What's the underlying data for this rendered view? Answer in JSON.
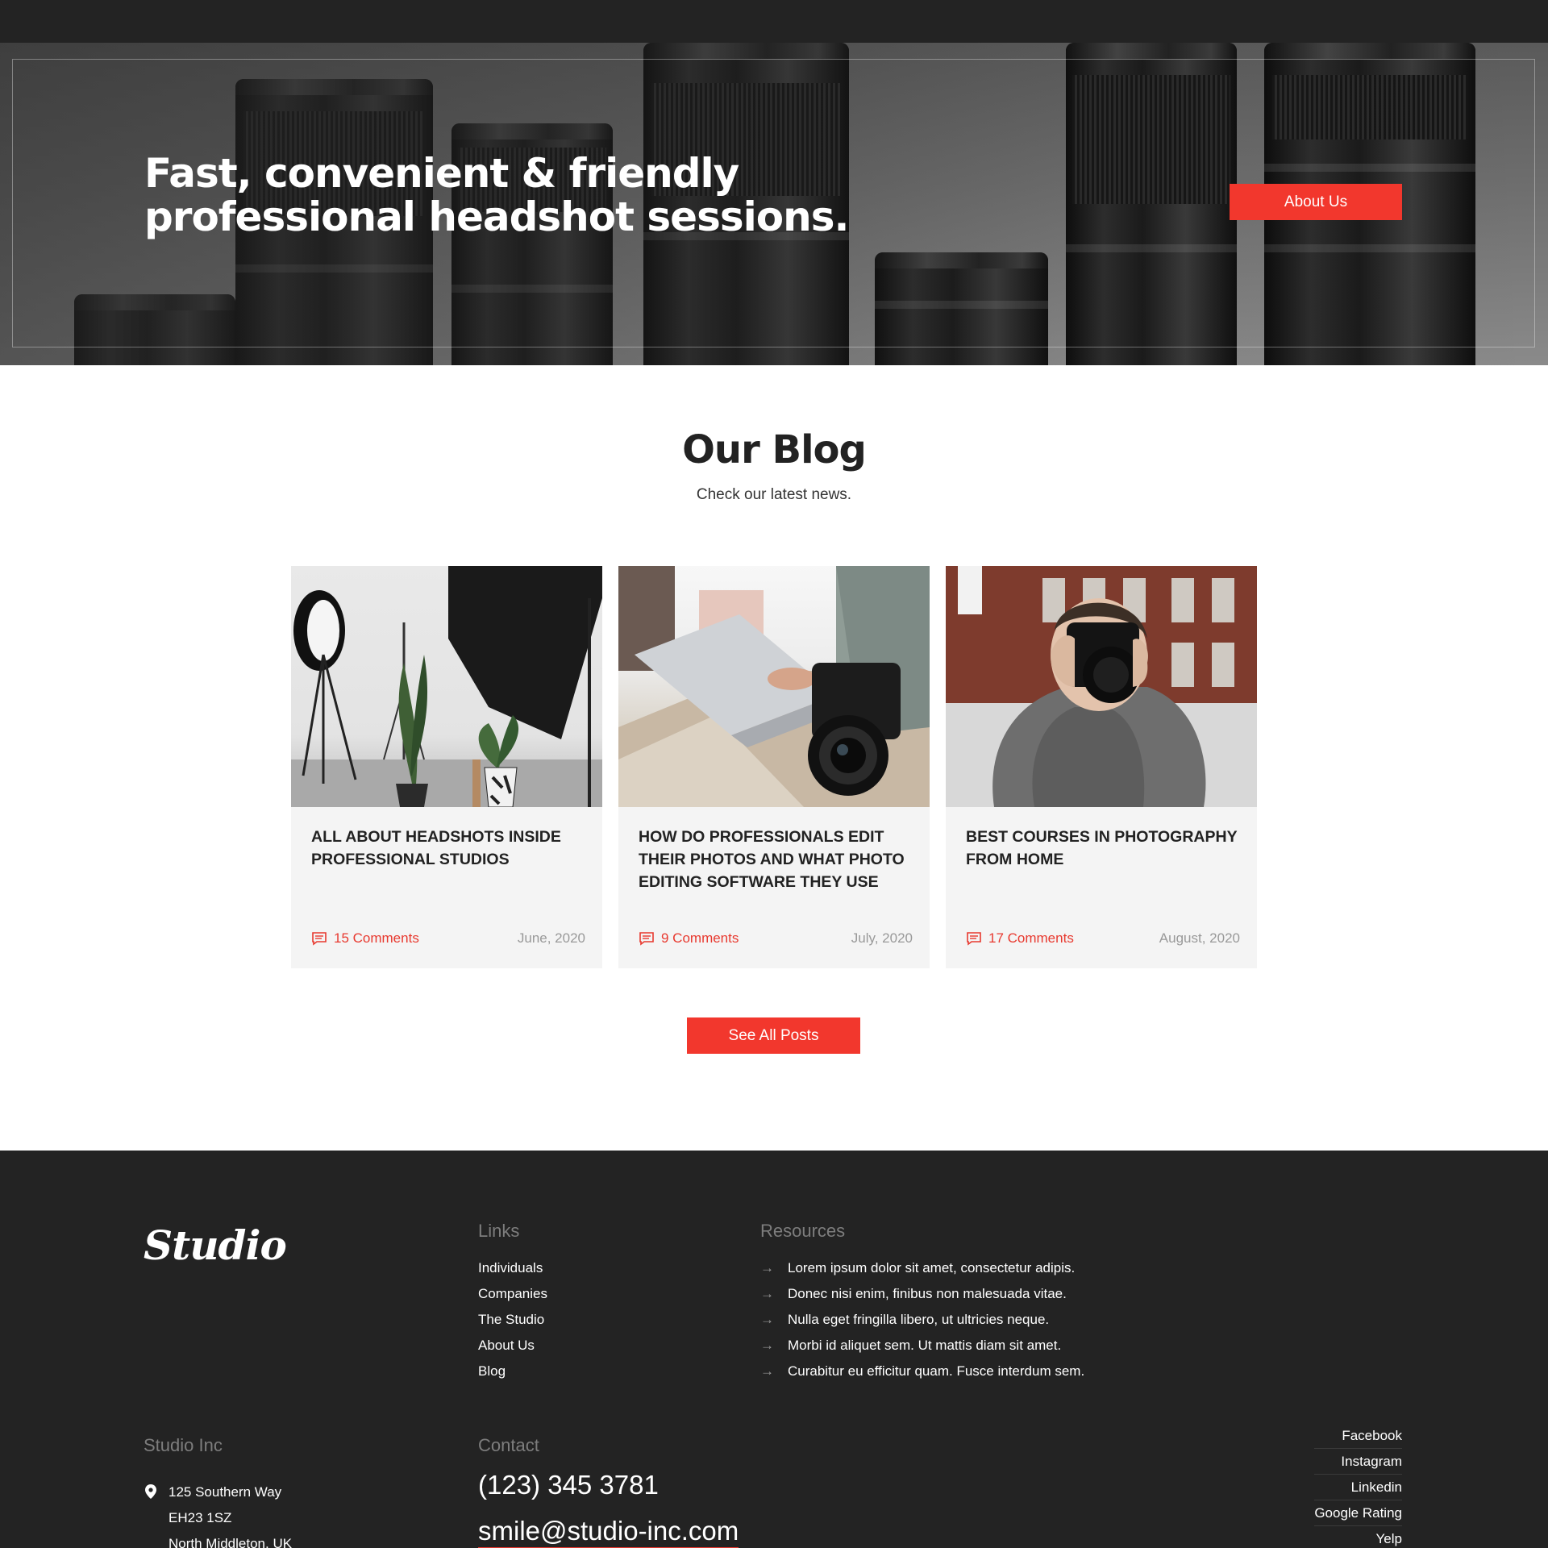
{
  "hero": {
    "headline": "Fast, convenient & friendly professional headshot sessions.",
    "cta": "About Us"
  },
  "blog": {
    "title": "Our Blog",
    "subtitle": "Check our latest news.",
    "posts": [
      {
        "title": "ALL ABOUT HEADSHOTS INSIDE PROFESSIONAL STUDIOS",
        "comments": "15 Comments",
        "date": "June, 2020"
      },
      {
        "title": "HOW DO PROFESSIONALS EDIT THEIR PHOTOS AND WHAT PHOTO EDITING SOFTWARE THEY USE",
        "comments": "9 Comments",
        "date": "July, 2020"
      },
      {
        "title": "BEST COURSES IN PHOTOGRAPHY FROM HOME",
        "comments": "17 Comments",
        "date": "August, 2020"
      }
    ],
    "see_all": "See All Posts"
  },
  "footer": {
    "logo": "Studio",
    "links_heading": "Links",
    "links": [
      "Individuals",
      "Companies",
      "The Studio",
      "About Us",
      "Blog"
    ],
    "resources_heading": "Resources",
    "resources": [
      "Lorem ipsum dolor sit amet, consectetur adipis.",
      "Donec nisi enim, finibus non malesuada vitae.",
      "Nulla eget fringilla libero, ut ultricies neque.",
      "Morbi id aliquet sem. Ut mattis diam sit amet.",
      "Curabitur eu efficitur quam. Fusce interdum sem."
    ],
    "company_heading": "Studio Inc",
    "address": [
      "125  Southern Way",
      "EH23 1SZ",
      "North Middleton, UK"
    ],
    "contact_heading": "Contact",
    "phone": "(123) 345 3781",
    "email": "smile@studio-inc.com",
    "social": [
      "Facebook",
      "Instagram",
      "Linkedin",
      "Google Rating",
      "Yelp"
    ]
  },
  "colors": {
    "accent": "#f2372d",
    "dark": "#232323",
    "card_bg": "#f4f4f4"
  },
  "icons": {
    "comment": "comment-icon",
    "pin": "map-pin-icon",
    "arrow": "arrow-right-icon"
  }
}
